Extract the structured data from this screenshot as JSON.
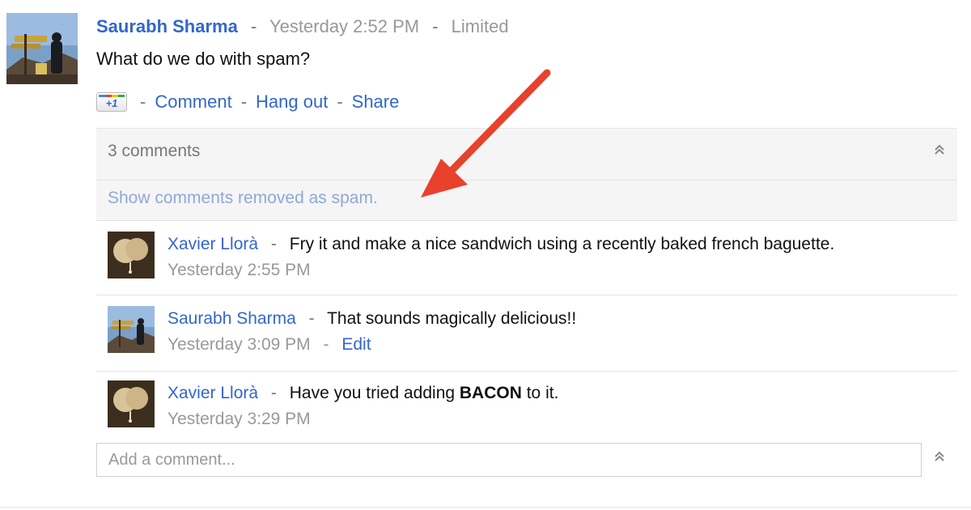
{
  "post": {
    "author": "Saurabh Sharma",
    "separator": "-",
    "timestamp": "Yesterday 2:52 PM",
    "visibility": "Limited",
    "text": "What do we do with spam?",
    "actions": {
      "plusone": "+1",
      "comment": "Comment",
      "hangout": "Hang out",
      "share": "Share"
    }
  },
  "comments_header": {
    "count_label": "3 comments",
    "spam_link": "Show comments removed as spam.",
    "collapse_glyph": "⌃"
  },
  "comments": [
    {
      "author": "Xavier Llorà",
      "text": "Fry it and make a nice sandwich using a recently baked french baguette.",
      "timestamp": "Yesterday 2:55 PM",
      "avatar": "sepia-balloons-avatar"
    },
    {
      "author": "Saurabh Sharma",
      "text": "That sounds magically delicious!!",
      "timestamp": "Yesterday 3:09 PM",
      "edit": "Edit",
      "avatar": "mountain-sign-avatar"
    },
    {
      "author": "Xavier Llorà",
      "text_before": "Have you tried adding ",
      "text_bold": "BACON",
      "text_after": " to it.",
      "timestamp": "Yesterday 3:29 PM",
      "avatar": "sepia-balloons-avatar"
    }
  ],
  "add_comment": {
    "placeholder": "Add a comment..."
  },
  "colors": {
    "link": "#3366cc",
    "muted": "#999999",
    "annotation_arrow": "#e8412c"
  }
}
